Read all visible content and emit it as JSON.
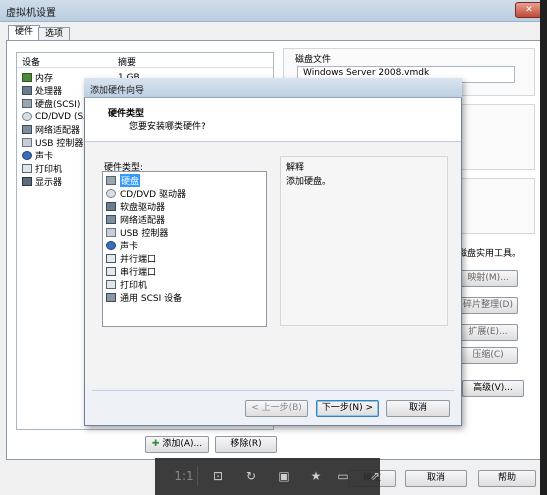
{
  "window": {
    "title": "虚拟机设置",
    "close_label": "✕"
  },
  "tabs": [
    {
      "label": "硬件"
    },
    {
      "label": "选项"
    }
  ],
  "device_list": {
    "headers": [
      "设备",
      "摘要"
    ],
    "devices": [
      {
        "name": "内存",
        "summary": "1 GB"
      },
      {
        "name": "处理器",
        "summary": ""
      },
      {
        "name": "硬盘(SCSI)",
        "summary": ""
      },
      {
        "name": "CD/DVD (SA",
        "summary": ""
      },
      {
        "name": "网络适配器",
        "summary": ""
      },
      {
        "name": "USB 控制器",
        "summary": ""
      },
      {
        "name": "声卡",
        "summary": ""
      },
      {
        "name": "打印机",
        "summary": ""
      },
      {
        "name": "显示器",
        "summary": ""
      }
    ]
  },
  "disk": {
    "label": "磁盘文件",
    "file": "Windows Server 2008.vmdk"
  },
  "utilities": {
    "text": "磁盘实用工具。",
    "map": "映射(M)...",
    "defrag": "碎片整理(D)",
    "expand": "扩展(E)...",
    "compress": "压缩(C)",
    "advanced": "高级(V)..."
  },
  "outer_buttons": {
    "add": "添加(A)...",
    "remove": "移除(R)",
    "ok": "确定",
    "cancel": "取消",
    "help": "帮助"
  },
  "dialog": {
    "title": "添加硬件向导",
    "heading": "硬件类型",
    "subheading": "您要安装哪类硬件?",
    "hw_label": "硬件类型:",
    "hw_items": [
      {
        "label": "硬盘"
      },
      {
        "label": "CD/DVD 驱动器"
      },
      {
        "label": "软盘驱动器"
      },
      {
        "label": "网络适配器"
      },
      {
        "label": "USB 控制器"
      },
      {
        "label": "声卡"
      },
      {
        "label": "并行端口"
      },
      {
        "label": "串行端口"
      },
      {
        "label": "打印机"
      },
      {
        "label": "通用 SCSI 设备"
      }
    ],
    "selected_item": "硬盘",
    "desc_label": "解释",
    "desc_text": "添加硬盘。",
    "back": "< 上一步(B)",
    "next": "下一步(N) >",
    "cancel": "取消"
  },
  "overlay": {
    "ratio": "1:1",
    "fit": "⊡",
    "rotate": "↻",
    "save": "▣",
    "bookmark": "★",
    "monitor": "▭",
    "share": "⇗"
  },
  "colors": {
    "selection": "#3399ff",
    "next_border": "#3c7fb1"
  }
}
